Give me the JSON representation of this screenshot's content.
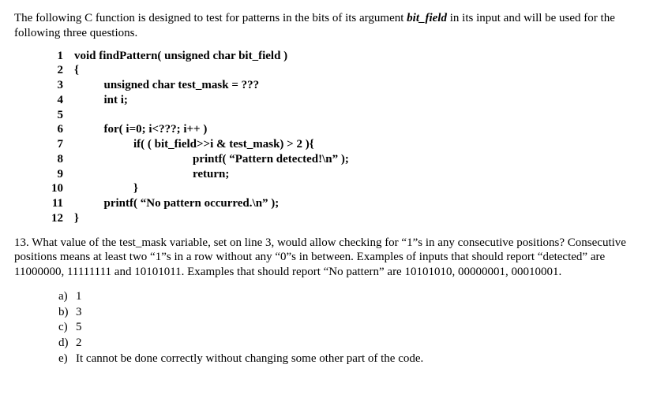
{
  "intro": {
    "text_before_em": "The following C function is designed to test for patterns in the bits of its argument ",
    "em": "bit_field",
    "text_after_em": " in its input and will be used for the following three questions."
  },
  "code": {
    "lines": [
      {
        "n": "1",
        "t": "void findPattern( unsigned char bit_field )"
      },
      {
        "n": "2",
        "t": "{"
      },
      {
        "n": "3",
        "t": "          unsigned char test_mask = ???"
      },
      {
        "n": "4",
        "t": "          int i;"
      },
      {
        "n": "5",
        "t": ""
      },
      {
        "n": "6",
        "t": "          for( i=0; i<???; i++ )"
      },
      {
        "n": "7",
        "t": "                    if( ( bit_field>>i & test_mask) > 2 ){"
      },
      {
        "n": "8",
        "t": "                                        printf( “Pattern detected!\\n” );"
      },
      {
        "n": "9",
        "t": "                                        return;"
      },
      {
        "n": "10",
        "t": "                    }"
      },
      {
        "n": "11",
        "t": "          printf( “No pattern occurred.\\n” );"
      },
      {
        "n": "12",
        "t": "}"
      }
    ]
  },
  "question": {
    "number_label": "13.",
    "text": "What value of the test_mask variable, set on line 3, would allow checking for “1”s in any consecutive positions? Consecutive positions means at least two “1”s in a row without any “0”s in between. Examples of inputs that should report “detected” are 11000000, 11111111 and 10101011. Examples that should report “No pattern” are 10101010, 00000001, 00010001."
  },
  "options": [
    {
      "letter": "a)",
      "text": "1"
    },
    {
      "letter": "b)",
      "text": "3"
    },
    {
      "letter": "c)",
      "text": "5"
    },
    {
      "letter": "d)",
      "text": "2"
    },
    {
      "letter": "e)",
      "text": "It cannot be done correctly without changing some other part of the code."
    }
  ]
}
